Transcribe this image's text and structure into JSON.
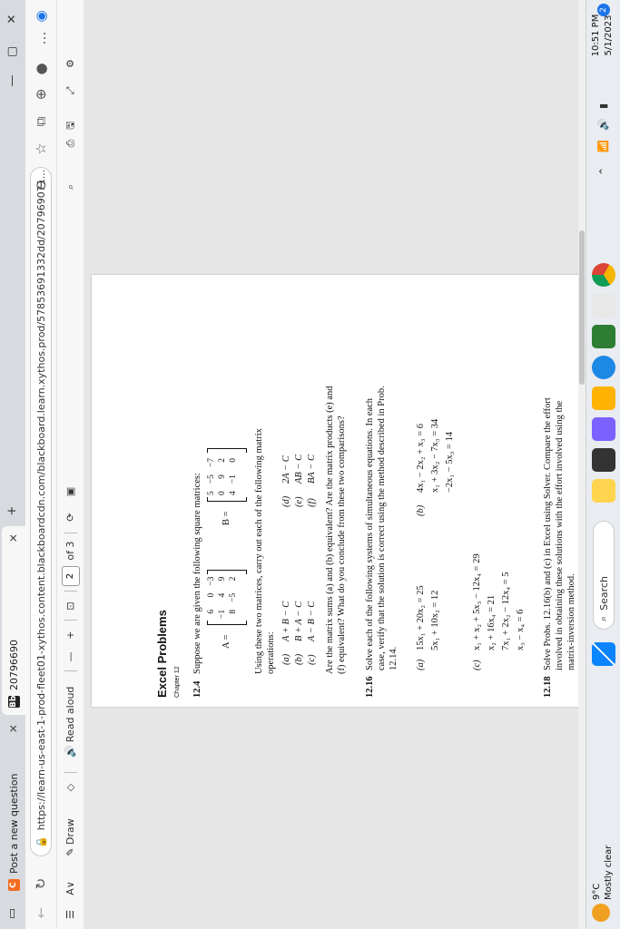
{
  "tabs": [
    {
      "label": "Post a new question",
      "favicon": "C",
      "color": "#f36d21"
    },
    {
      "label": "20796690",
      "favicon": "Bb",
      "color": "#222"
    }
  ],
  "new_tab": "+",
  "window_controls": {
    "minimize": "—",
    "maximize": "▢",
    "close": "✕"
  },
  "address": {
    "url": "https://learn-us-east-1-prod-fleet01-xythos.content.blackboardcdn.com/blackboard.learn.xythos.prod/57853691332dd/207969071..."
  },
  "pdf_toolbar": {
    "draw": "Draw",
    "read_aloud": "Read aloud",
    "minus": "—",
    "plus": "+",
    "page_current": "2",
    "page_total": "of 3"
  },
  "pdf": {
    "title": "Excel Problems",
    "chapter": "Chapter 12",
    "p12_4": {
      "num": "12.4",
      "intro": "Suppose we are given the following square matrices:",
      "A_label": "A =",
      "A": [
        [
          "6",
          "0",
          "−3"
        ],
        [
          "−1",
          "4",
          "9"
        ],
        [
          "8",
          "−5",
          "2"
        ]
      ],
      "B_label": "B =",
      "B": [
        [
          "5",
          "−5",
          "−7"
        ],
        [
          "0",
          "9",
          "2"
        ],
        [
          "4",
          "−1",
          "0"
        ]
      ],
      "ops_line1": "Using these two matrices, carry out each of the following matrix",
      "ops_line2": "operations:",
      "ops": [
        {
          "l": "(a)",
          "e": "A + B − C"
        },
        {
          "l": "(b)",
          "e": "B + A − C"
        },
        {
          "l": "(c)",
          "e": "A − B − C"
        },
        {
          "l": "(d)",
          "e": "2A − C"
        },
        {
          "l": "(e)",
          "e": "AB − C"
        },
        {
          "l": "(f)",
          "e": "BA − C"
        }
      ],
      "q1": "Are the matrix sums (a) and (b) equivalent? Are the matrix products (e) and",
      "q2": "(f) equivalent? What do you conclude from these two comparisons?"
    },
    "p12_16": {
      "num": "12.16",
      "l1": "Solve each of the following systems of simultaneous equations. In each",
      "l2": "case, verify that the solution is correct using the method described in Prob.",
      "l3": "12.14.",
      "a_label": "(a)",
      "a": [
        "15x₁ + 20x₂ = 25",
        "5x₁ + 10x₂ = 12"
      ],
      "b_label": "(b)",
      "b": [
        "4x₁ − 2x₂ + x₃ = 6",
        "x₁ + 3x₂ − 7x₃ = 34",
        "−2x₁ − 5x₃ = 14"
      ],
      "c_label": "(c)",
      "c": [
        "x₁ + x₂ + 5x₃ − 12x₄ = 29",
        "x₂ + 16x₄ = 21",
        "7x₁ + 2x₂ − 12x₄ = 5",
        "x₃ − x₄ = 6"
      ]
    },
    "p12_18": {
      "num": "12.18",
      "l1": "Solve Probs. 12.16(b) and (c) in Excel using Solver. Compare the effort",
      "l2": "involved in obtaining these solutions with the effort involved using the",
      "l3": "matrix-inversion method."
    }
  },
  "taskbar": {
    "weather_temp": "9°C",
    "weather_desc": "Mostly clear",
    "search": "Search",
    "time": "10:51 PM",
    "date": "5/1/2023",
    "notif_count": "2"
  }
}
